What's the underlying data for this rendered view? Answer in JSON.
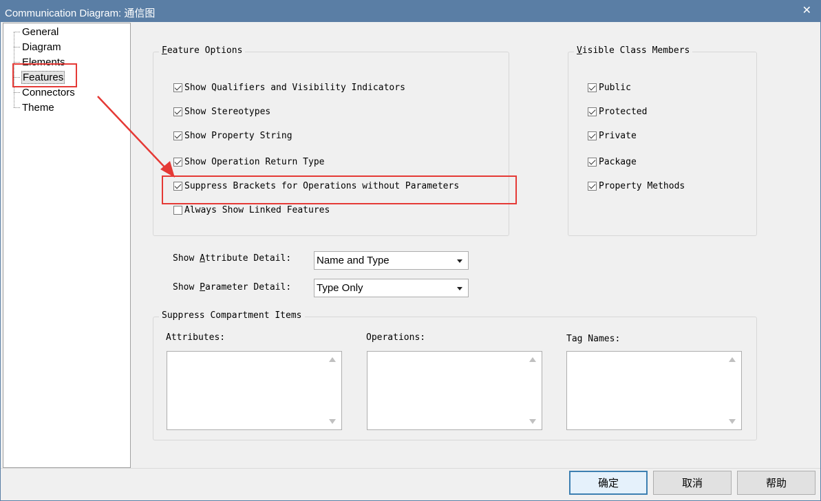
{
  "window": {
    "title": "Communication Diagram: 通信图",
    "close_glyph": "✕"
  },
  "tree": {
    "items": [
      "General",
      "Diagram",
      "Elements",
      "Features",
      "Connectors",
      "Theme"
    ],
    "selected_index": 3
  },
  "feature_options": {
    "legend_prefix": "",
    "legend_accel": "F",
    "legend_rest": "eature Options",
    "items": [
      {
        "label": "Show Qualifiers and Visibility Indicators",
        "checked": true
      },
      {
        "label": "Show Stereotypes",
        "checked": true
      },
      {
        "label": "Show Property String",
        "checked": true
      },
      {
        "label": "Show Operation Return Type",
        "checked": true
      },
      {
        "label": "Suppress Brackets for Operations without Parameters",
        "checked": true
      },
      {
        "label": "Always Show Linked Features",
        "checked": false
      }
    ]
  },
  "visible_members": {
    "legend_accel": "V",
    "legend_rest": "isible Class Members",
    "items": [
      {
        "label": "Public",
        "checked": true
      },
      {
        "label": "Protected",
        "checked": true
      },
      {
        "label": "Private",
        "checked": true
      },
      {
        "label": "Package",
        "checked": true
      },
      {
        "label": "Property Methods",
        "checked": true
      }
    ]
  },
  "attribute_detail": {
    "label_pre": "Show ",
    "label_accel": "A",
    "label_post": "ttribute Detail:",
    "value": "Name and Type"
  },
  "parameter_detail": {
    "label_pre": "Show ",
    "label_accel": "P",
    "label_post": "arameter Detail:",
    "value": "Type Only"
  },
  "suppress": {
    "legend": "Suppress Compartment Items",
    "attributes_label": "Attributes:",
    "operations_label": "Operations:",
    "tagnames_label": "Tag Names:"
  },
  "buttons": {
    "ok": "确定",
    "cancel": "取消",
    "help": "帮助"
  },
  "colors": {
    "titlebar": "#5a7ea5",
    "highlight": "#e53935"
  }
}
